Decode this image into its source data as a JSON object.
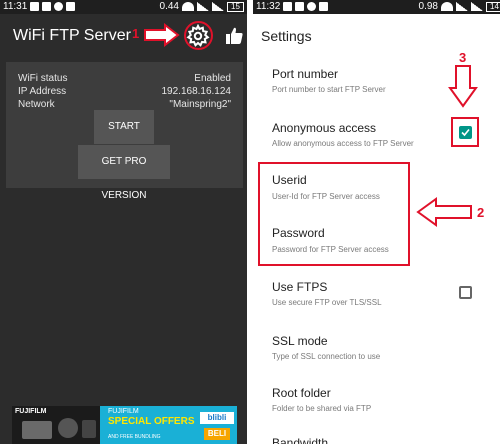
{
  "left": {
    "status": {
      "time": "11:31",
      "percent": "0.44",
      "battery": "15"
    },
    "app_title": "WiFi FTP Server",
    "card": {
      "labels": [
        "WiFi status",
        "IP Address",
        "Network"
      ],
      "values": [
        "Enabled",
        "192.168.16.124",
        "\"Mainspring2\""
      ]
    },
    "start_button": "START",
    "pro_button": "GET PRO VERSION",
    "icons": {
      "settings": "gear-icon",
      "rate": "thumbs-up-icon"
    },
    "ad": {
      "brand_left": "FUJIFILM",
      "brand_right": "FUJIFILM",
      "headline": "SPECIAL OFFERS",
      "subline": "AND FREE BUNDLING",
      "cta": "BELI",
      "logo": "blibli"
    }
  },
  "right": {
    "status": {
      "time": "11:32",
      "percent": "0.98",
      "battery": "14"
    },
    "title": "Settings",
    "items": [
      {
        "title": "Port number",
        "subtitle": "Port number to start FTP Server"
      },
      {
        "title": "Anonymous access",
        "subtitle": "Allow anonymous access to FTP Server",
        "checked": true
      },
      {
        "title": "Userid",
        "subtitle": "User-Id for FTP Server access"
      },
      {
        "title": "Password",
        "subtitle": "Password for FTP Server access"
      },
      {
        "title": "Use FTPS",
        "subtitle": "Use secure FTP over TLS/SSL",
        "checked": false
      },
      {
        "title": "SSL mode",
        "subtitle": "Type of SSL connection to use"
      },
      {
        "title": "Root folder",
        "subtitle": "Folder to be shared via FTP"
      },
      {
        "title": "Bandwidth",
        "subtitle": ""
      }
    ]
  },
  "annotations": [
    "1",
    "2",
    "3"
  ],
  "colors": {
    "annotation_red": "#e0112a",
    "accent_teal": "#009688"
  }
}
